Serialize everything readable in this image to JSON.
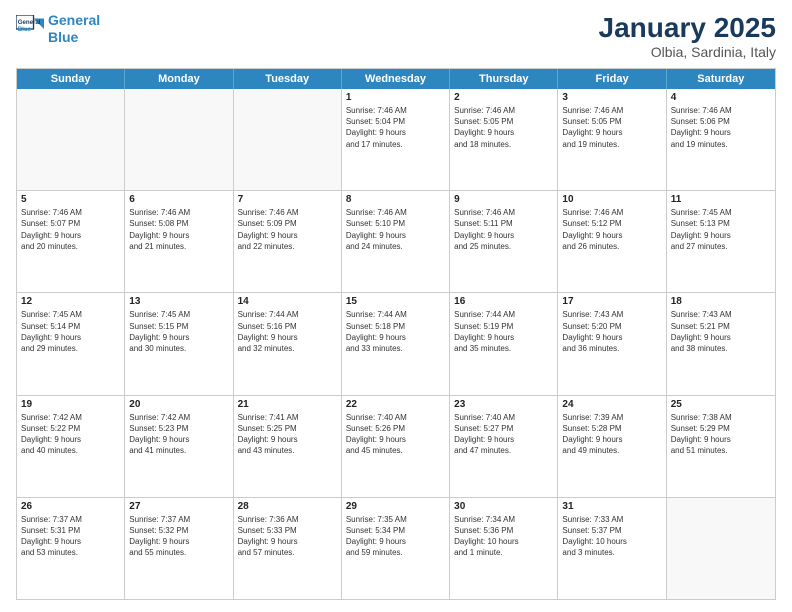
{
  "header": {
    "logo_line1": "General",
    "logo_line2": "Blue",
    "month": "January 2025",
    "location": "Olbia, Sardinia, Italy"
  },
  "weekdays": [
    "Sunday",
    "Monday",
    "Tuesday",
    "Wednesday",
    "Thursday",
    "Friday",
    "Saturday"
  ],
  "rows": [
    [
      {
        "day": "",
        "info": ""
      },
      {
        "day": "",
        "info": ""
      },
      {
        "day": "",
        "info": ""
      },
      {
        "day": "1",
        "info": "Sunrise: 7:46 AM\nSunset: 5:04 PM\nDaylight: 9 hours\nand 17 minutes."
      },
      {
        "day": "2",
        "info": "Sunrise: 7:46 AM\nSunset: 5:05 PM\nDaylight: 9 hours\nand 18 minutes."
      },
      {
        "day": "3",
        "info": "Sunrise: 7:46 AM\nSunset: 5:05 PM\nDaylight: 9 hours\nand 19 minutes."
      },
      {
        "day": "4",
        "info": "Sunrise: 7:46 AM\nSunset: 5:06 PM\nDaylight: 9 hours\nand 19 minutes."
      }
    ],
    [
      {
        "day": "5",
        "info": "Sunrise: 7:46 AM\nSunset: 5:07 PM\nDaylight: 9 hours\nand 20 minutes."
      },
      {
        "day": "6",
        "info": "Sunrise: 7:46 AM\nSunset: 5:08 PM\nDaylight: 9 hours\nand 21 minutes."
      },
      {
        "day": "7",
        "info": "Sunrise: 7:46 AM\nSunset: 5:09 PM\nDaylight: 9 hours\nand 22 minutes."
      },
      {
        "day": "8",
        "info": "Sunrise: 7:46 AM\nSunset: 5:10 PM\nDaylight: 9 hours\nand 24 minutes."
      },
      {
        "day": "9",
        "info": "Sunrise: 7:46 AM\nSunset: 5:11 PM\nDaylight: 9 hours\nand 25 minutes."
      },
      {
        "day": "10",
        "info": "Sunrise: 7:46 AM\nSunset: 5:12 PM\nDaylight: 9 hours\nand 26 minutes."
      },
      {
        "day": "11",
        "info": "Sunrise: 7:45 AM\nSunset: 5:13 PM\nDaylight: 9 hours\nand 27 minutes."
      }
    ],
    [
      {
        "day": "12",
        "info": "Sunrise: 7:45 AM\nSunset: 5:14 PM\nDaylight: 9 hours\nand 29 minutes."
      },
      {
        "day": "13",
        "info": "Sunrise: 7:45 AM\nSunset: 5:15 PM\nDaylight: 9 hours\nand 30 minutes."
      },
      {
        "day": "14",
        "info": "Sunrise: 7:44 AM\nSunset: 5:16 PM\nDaylight: 9 hours\nand 32 minutes."
      },
      {
        "day": "15",
        "info": "Sunrise: 7:44 AM\nSunset: 5:18 PM\nDaylight: 9 hours\nand 33 minutes."
      },
      {
        "day": "16",
        "info": "Sunrise: 7:44 AM\nSunset: 5:19 PM\nDaylight: 9 hours\nand 35 minutes."
      },
      {
        "day": "17",
        "info": "Sunrise: 7:43 AM\nSunset: 5:20 PM\nDaylight: 9 hours\nand 36 minutes."
      },
      {
        "day": "18",
        "info": "Sunrise: 7:43 AM\nSunset: 5:21 PM\nDaylight: 9 hours\nand 38 minutes."
      }
    ],
    [
      {
        "day": "19",
        "info": "Sunrise: 7:42 AM\nSunset: 5:22 PM\nDaylight: 9 hours\nand 40 minutes."
      },
      {
        "day": "20",
        "info": "Sunrise: 7:42 AM\nSunset: 5:23 PM\nDaylight: 9 hours\nand 41 minutes."
      },
      {
        "day": "21",
        "info": "Sunrise: 7:41 AM\nSunset: 5:25 PM\nDaylight: 9 hours\nand 43 minutes."
      },
      {
        "day": "22",
        "info": "Sunrise: 7:40 AM\nSunset: 5:26 PM\nDaylight: 9 hours\nand 45 minutes."
      },
      {
        "day": "23",
        "info": "Sunrise: 7:40 AM\nSunset: 5:27 PM\nDaylight: 9 hours\nand 47 minutes."
      },
      {
        "day": "24",
        "info": "Sunrise: 7:39 AM\nSunset: 5:28 PM\nDaylight: 9 hours\nand 49 minutes."
      },
      {
        "day": "25",
        "info": "Sunrise: 7:38 AM\nSunset: 5:29 PM\nDaylight: 9 hours\nand 51 minutes."
      }
    ],
    [
      {
        "day": "26",
        "info": "Sunrise: 7:37 AM\nSunset: 5:31 PM\nDaylight: 9 hours\nand 53 minutes."
      },
      {
        "day": "27",
        "info": "Sunrise: 7:37 AM\nSunset: 5:32 PM\nDaylight: 9 hours\nand 55 minutes."
      },
      {
        "day": "28",
        "info": "Sunrise: 7:36 AM\nSunset: 5:33 PM\nDaylight: 9 hours\nand 57 minutes."
      },
      {
        "day": "29",
        "info": "Sunrise: 7:35 AM\nSunset: 5:34 PM\nDaylight: 9 hours\nand 59 minutes."
      },
      {
        "day": "30",
        "info": "Sunrise: 7:34 AM\nSunset: 5:36 PM\nDaylight: 10 hours\nand 1 minute."
      },
      {
        "day": "31",
        "info": "Sunrise: 7:33 AM\nSunset: 5:37 PM\nDaylight: 10 hours\nand 3 minutes."
      },
      {
        "day": "",
        "info": ""
      }
    ]
  ]
}
